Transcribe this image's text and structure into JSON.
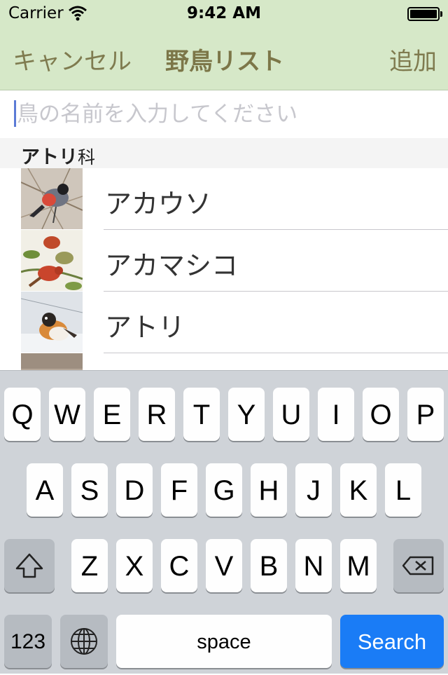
{
  "status_bar": {
    "carrier": "Carrier",
    "time": "9:42 AM"
  },
  "nav": {
    "cancel": "キャンセル",
    "title": "野鳥リスト",
    "add": "追加"
  },
  "search": {
    "placeholder": "鳥の名前を入力してください",
    "value": ""
  },
  "section": {
    "title": "アトリ",
    "suffix": "科"
  },
  "birds": [
    {
      "name": "アカウソ"
    },
    {
      "name": "アカマシコ"
    },
    {
      "name": "アトリ"
    }
  ],
  "keyboard": {
    "row1": [
      "Q",
      "W",
      "E",
      "R",
      "T",
      "Y",
      "U",
      "I",
      "O",
      "P"
    ],
    "row2": [
      "A",
      "S",
      "D",
      "F",
      "G",
      "H",
      "J",
      "K",
      "L"
    ],
    "row3": [
      "Z",
      "X",
      "C",
      "V",
      "B",
      "N",
      "M"
    ],
    "numbers": "123",
    "space": "space",
    "search": "Search"
  },
  "colors": {
    "nav_bg": "#d6e8c8",
    "nav_text": "#7f7b4f",
    "search_key": "#1a7cf6"
  }
}
